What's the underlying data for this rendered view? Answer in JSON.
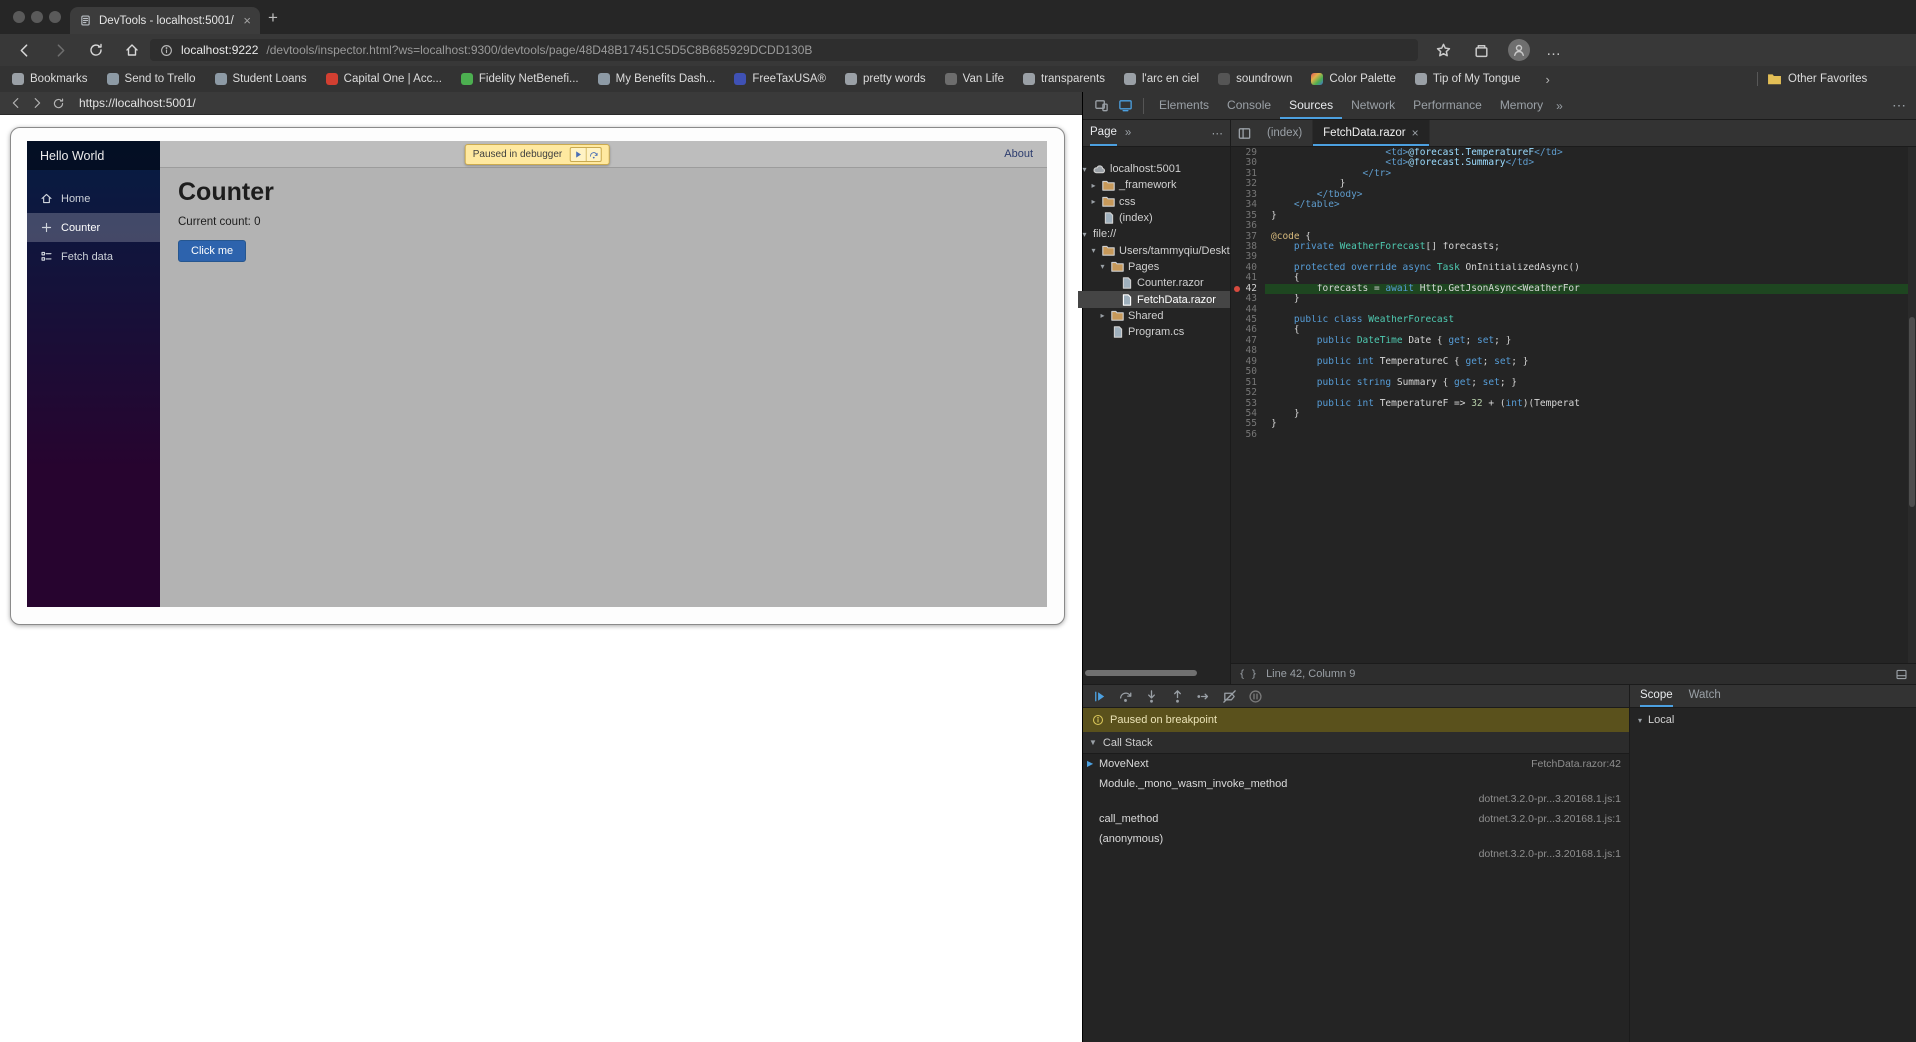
{
  "ui": {
    "overflow_glyph": "»",
    "menu_glyph": "⋯",
    "dots_glyph": "…",
    "bookmarks_chevron": "›",
    "plus_glyph": "+",
    "close_glyph": "×",
    "braces_glyph": "{ }",
    "triangle_down": "▼",
    "triangle_down_small": "▾"
  },
  "browser": {
    "tab": {
      "title": "DevTools - localhost:5001/"
    },
    "address": {
      "host": "localhost:9222",
      "path": "/devtools/inspector.html?ws=localhost:9300/devtools/page/48D48B17451C5D5C8B685929DCDD130B"
    },
    "bookmarks": {
      "items": [
        {
          "label": "Bookmarks",
          "color": "#9aa0a6"
        },
        {
          "label": "Send to Trello",
          "color": "#8d9aa5"
        },
        {
          "label": "Student Loans",
          "color": "#8d9aa5"
        },
        {
          "label": "Capital One | Acc...",
          "color": "#d23f31"
        },
        {
          "label": "Fidelity NetBenefi...",
          "color": "#4caf50"
        },
        {
          "label": "My Benefits Dash...",
          "color": "#8d9aa5"
        },
        {
          "label": "FreeTaxUSA®",
          "color": "#3f51b5"
        },
        {
          "label": "pretty words",
          "color": "#9aa0a6"
        },
        {
          "label": "Van Life",
          "color": "#6d6d6d"
        },
        {
          "label": "transparents",
          "color": "#9aa0a6"
        },
        {
          "label": "l'arc en ciel",
          "color": "#9aa0a6"
        },
        {
          "label": "soundrown",
          "color": "#555555"
        },
        {
          "label": "Color Palette",
          "color": "#e2b04a",
          "gradient": true
        },
        {
          "label": "Tip of My Tongue",
          "color": "#9aa0a6"
        }
      ],
      "other_label": "Other Favorites"
    }
  },
  "screencast": {
    "url": "https://localhost:5001/",
    "app": {
      "brand": "Hello World",
      "nav": [
        {
          "label": "Home",
          "icon": "home",
          "active": false
        },
        {
          "label": "Counter",
          "icon": "plus",
          "active": true
        },
        {
          "label": "Fetch data",
          "icon": "list",
          "active": false
        }
      ],
      "about_label": "About",
      "heading": "Counter",
      "count_text": "Current count: 0",
      "button_label": "Click me",
      "paused_banner": "Paused in debugger"
    }
  },
  "devtools": {
    "tabs": [
      "Elements",
      "Console",
      "Sources",
      "Network",
      "Performance",
      "Memory"
    ],
    "active_tab": "Sources",
    "navigator": {
      "tab_label": "Page",
      "tree": [
        {
          "label": "localhost:5001",
          "depth": 0,
          "icon": "cloud",
          "exp": true
        },
        {
          "label": "_framework",
          "depth": 1,
          "icon": "folder",
          "exp": false
        },
        {
          "label": "css",
          "depth": 1,
          "icon": "folder",
          "exp": false
        },
        {
          "label": "(index)",
          "depth": 1,
          "icon": "file"
        },
        {
          "label": "file://",
          "depth": 0,
          "icon": "none",
          "exp": true
        },
        {
          "label": "Users/tammyqiu/Desktop/Deskt",
          "depth": 1,
          "icon": "folder",
          "exp": true
        },
        {
          "label": "Pages",
          "depth": 2,
          "icon": "folder",
          "exp": true
        },
        {
          "label": "Counter.razor",
          "depth": 3,
          "icon": "file"
        },
        {
          "label": "FetchData.razor",
          "depth": 3,
          "icon": "file",
          "selected": true
        },
        {
          "label": "Shared",
          "depth": 2,
          "icon": "folder",
          "exp": false
        },
        {
          "label": "Program.cs",
          "depth": 2,
          "icon": "file"
        }
      ]
    },
    "editor": {
      "tabs": [
        {
          "label": "(index)",
          "active": false,
          "closable": false
        },
        {
          "label": "FetchData.razor",
          "active": true,
          "closable": true
        }
      ],
      "breakpoint_line": 42,
      "execution_line": 42,
      "status_text": "Line 42, Column 9",
      "lines": [
        {
          "n": 29,
          "toks": [
            [
              "pl",
              "                    "
            ],
            [
              "tag",
              "<td>"
            ],
            [
              "rz",
              "@forecast.TemperatureF"
            ],
            [
              "tag",
              "</td>"
            ]
          ]
        },
        {
          "n": 30,
          "toks": [
            [
              "pl",
              "                    "
            ],
            [
              "tag",
              "<td>"
            ],
            [
              "rz",
              "@forecast.Summary"
            ],
            [
              "tag",
              "</td>"
            ]
          ]
        },
        {
          "n": 31,
          "toks": [
            [
              "pl",
              "                "
            ],
            [
              "tag",
              "</tr>"
            ]
          ]
        },
        {
          "n": 32,
          "toks": [
            [
              "pl",
              "            }"
            ]
          ]
        },
        {
          "n": 33,
          "toks": [
            [
              "pl",
              "        "
            ],
            [
              "tag",
              "</tbody>"
            ]
          ]
        },
        {
          "n": 34,
          "toks": [
            [
              "pl",
              "    "
            ],
            [
              "tag",
              "</table>"
            ]
          ]
        },
        {
          "n": 35,
          "toks": [
            [
              "pl",
              "}"
            ]
          ]
        },
        {
          "n": 36,
          "toks": []
        },
        {
          "n": 37,
          "toks": [
            [
              "at",
              "@code"
            ],
            [
              "pl",
              " {"
            ]
          ]
        },
        {
          "n": 38,
          "toks": [
            [
              "pl",
              "    "
            ],
            [
              "kw",
              "private"
            ],
            [
              "pl",
              " "
            ],
            [
              "typ",
              "WeatherForecast"
            ],
            [
              "pl",
              "[] forecasts;"
            ]
          ]
        },
        {
          "n": 39,
          "toks": []
        },
        {
          "n": 40,
          "toks": [
            [
              "pl",
              "    "
            ],
            [
              "kw",
              "protected override async"
            ],
            [
              "pl",
              " "
            ],
            [
              "typ",
              "Task"
            ],
            [
              "pl",
              " OnInitializedAsync()"
            ]
          ]
        },
        {
          "n": 41,
          "toks": [
            [
              "pl",
              "    {"
            ]
          ]
        },
        {
          "n": 42,
          "toks": [
            [
              "pl",
              "        forecasts = "
            ],
            [
              "kw",
              "await"
            ],
            [
              "pl",
              " Http.GetJsonAsync<WeatherFor"
            ]
          ]
        },
        {
          "n": 43,
          "toks": [
            [
              "pl",
              "    }"
            ]
          ]
        },
        {
          "n": 44,
          "toks": []
        },
        {
          "n": 45,
          "toks": [
            [
              "pl",
              "    "
            ],
            [
              "kw",
              "public class"
            ],
            [
              "pl",
              " "
            ],
            [
              "typ",
              "WeatherForecast"
            ]
          ]
        },
        {
          "n": 46,
          "toks": [
            [
              "pl",
              "    {"
            ]
          ]
        },
        {
          "n": 47,
          "toks": [
            [
              "pl",
              "        "
            ],
            [
              "kw",
              "public"
            ],
            [
              "pl",
              " "
            ],
            [
              "typ",
              "DateTime"
            ],
            [
              "pl",
              " Date { "
            ],
            [
              "kw",
              "get"
            ],
            [
              "pl",
              "; "
            ],
            [
              "kw",
              "set"
            ],
            [
              "pl",
              "; }"
            ]
          ]
        },
        {
          "n": 48,
          "toks": []
        },
        {
          "n": 49,
          "toks": [
            [
              "pl",
              "        "
            ],
            [
              "kw",
              "public int"
            ],
            [
              "pl",
              " TemperatureC { "
            ],
            [
              "kw",
              "get"
            ],
            [
              "pl",
              "; "
            ],
            [
              "kw",
              "set"
            ],
            [
              "pl",
              "; }"
            ]
          ]
        },
        {
          "n": 50,
          "toks": []
        },
        {
          "n": 51,
          "toks": [
            [
              "pl",
              "        "
            ],
            [
              "kw",
              "public string"
            ],
            [
              "pl",
              " Summary { "
            ],
            [
              "kw",
              "get"
            ],
            [
              "pl",
              "; "
            ],
            [
              "kw",
              "set"
            ],
            [
              "pl",
              "; }"
            ]
          ]
        },
        {
          "n": 52,
          "toks": []
        },
        {
          "n": 53,
          "toks": [
            [
              "pl",
              "        "
            ],
            [
              "kw",
              "public int"
            ],
            [
              "pl",
              " TemperatureF => "
            ],
            [
              "num",
              "32"
            ],
            [
              "pl",
              " + ("
            ],
            [
              "kw",
              "int"
            ],
            [
              "pl",
              ")(Temperat"
            ]
          ]
        },
        {
          "n": 54,
          "toks": [
            [
              "pl",
              "    }"
            ]
          ]
        },
        {
          "n": 55,
          "toks": [
            [
              "pl",
              "}"
            ]
          ]
        },
        {
          "n": 56,
          "toks": []
        }
      ]
    },
    "debugger": {
      "toolbar": [
        "resume",
        "step-over",
        "step-into",
        "step-out",
        "step",
        "deactivate-breakpoints",
        "pause-on-exceptions"
      ],
      "paused_message": "Paused on breakpoint",
      "call_stack_title": "Call Stack",
      "frames": [
        {
          "fn": "MoveNext",
          "loc": "FetchData.razor:42",
          "current": true,
          "wrap": false
        },
        {
          "fn": "Module._mono_wasm_invoke_method",
          "loc": "dotnet.3.2.0-pr...3.20168.1.js:1",
          "current": false,
          "wrap": true
        },
        {
          "fn": "call_method",
          "loc": "dotnet.3.2.0-pr...3.20168.1.js:1",
          "current": false,
          "wrap": false
        },
        {
          "fn": "(anonymous)",
          "loc": "dotnet.3.2.0-pr...3.20168.1.js:1",
          "current": false,
          "wrap": true
        }
      ],
      "side_tabs": [
        "Scope",
        "Watch"
      ],
      "active_side_tab": "Scope",
      "scope_local": "Local"
    }
  },
  "colors": {
    "accent": "#4ca0e0",
    "breakpoint": "#d74b3f",
    "execution_line_bg": "#1e4620",
    "page_paused_banner_bg": "#ffe9a0",
    "panel_paused_banner_bg": "#5a511c"
  }
}
